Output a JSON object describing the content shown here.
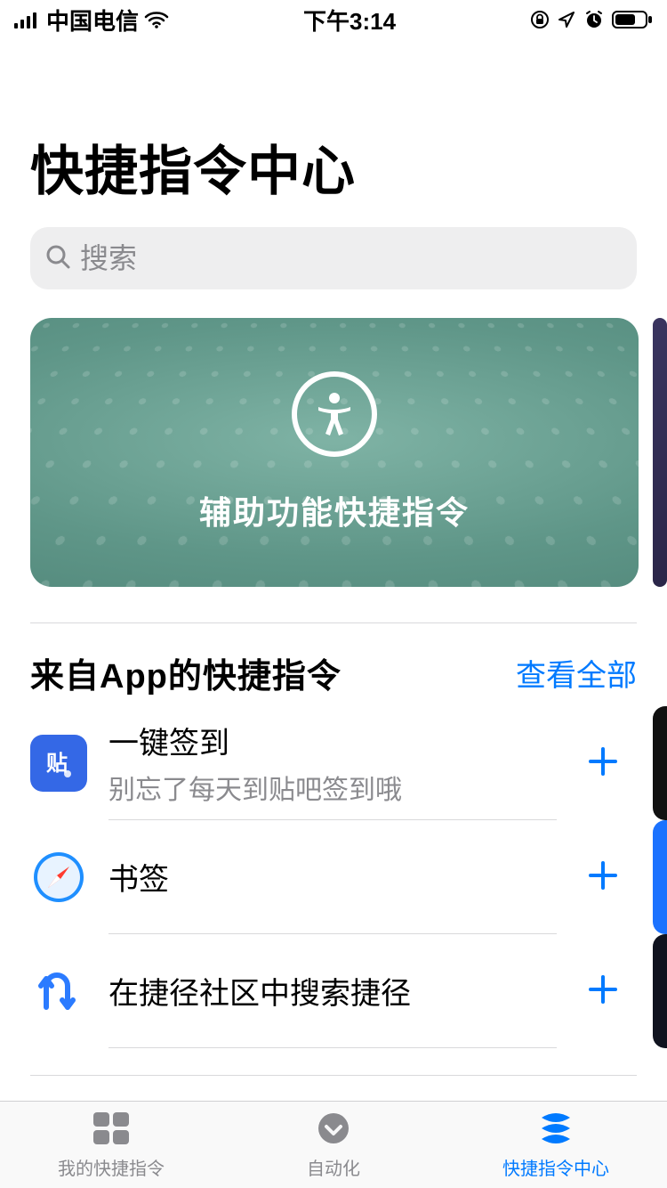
{
  "status": {
    "carrier": "中国电信",
    "time": "下午3:14"
  },
  "page": {
    "title": "快捷指令中心"
  },
  "search": {
    "placeholder": "搜索"
  },
  "featured": {
    "label": "辅助功能快捷指令"
  },
  "section1": {
    "title": "来自App的快捷指令",
    "link": "查看全部",
    "items": [
      {
        "title": "一键签到",
        "subtitle": "别忘了每天到贴吧签到哦"
      },
      {
        "title": "书签",
        "subtitle": ""
      },
      {
        "title": "在捷径社区中搜索捷径",
        "subtitle": ""
      }
    ]
  },
  "tabs": {
    "my": "我的快捷指令",
    "automation": "自动化",
    "gallery": "快捷指令中心"
  }
}
